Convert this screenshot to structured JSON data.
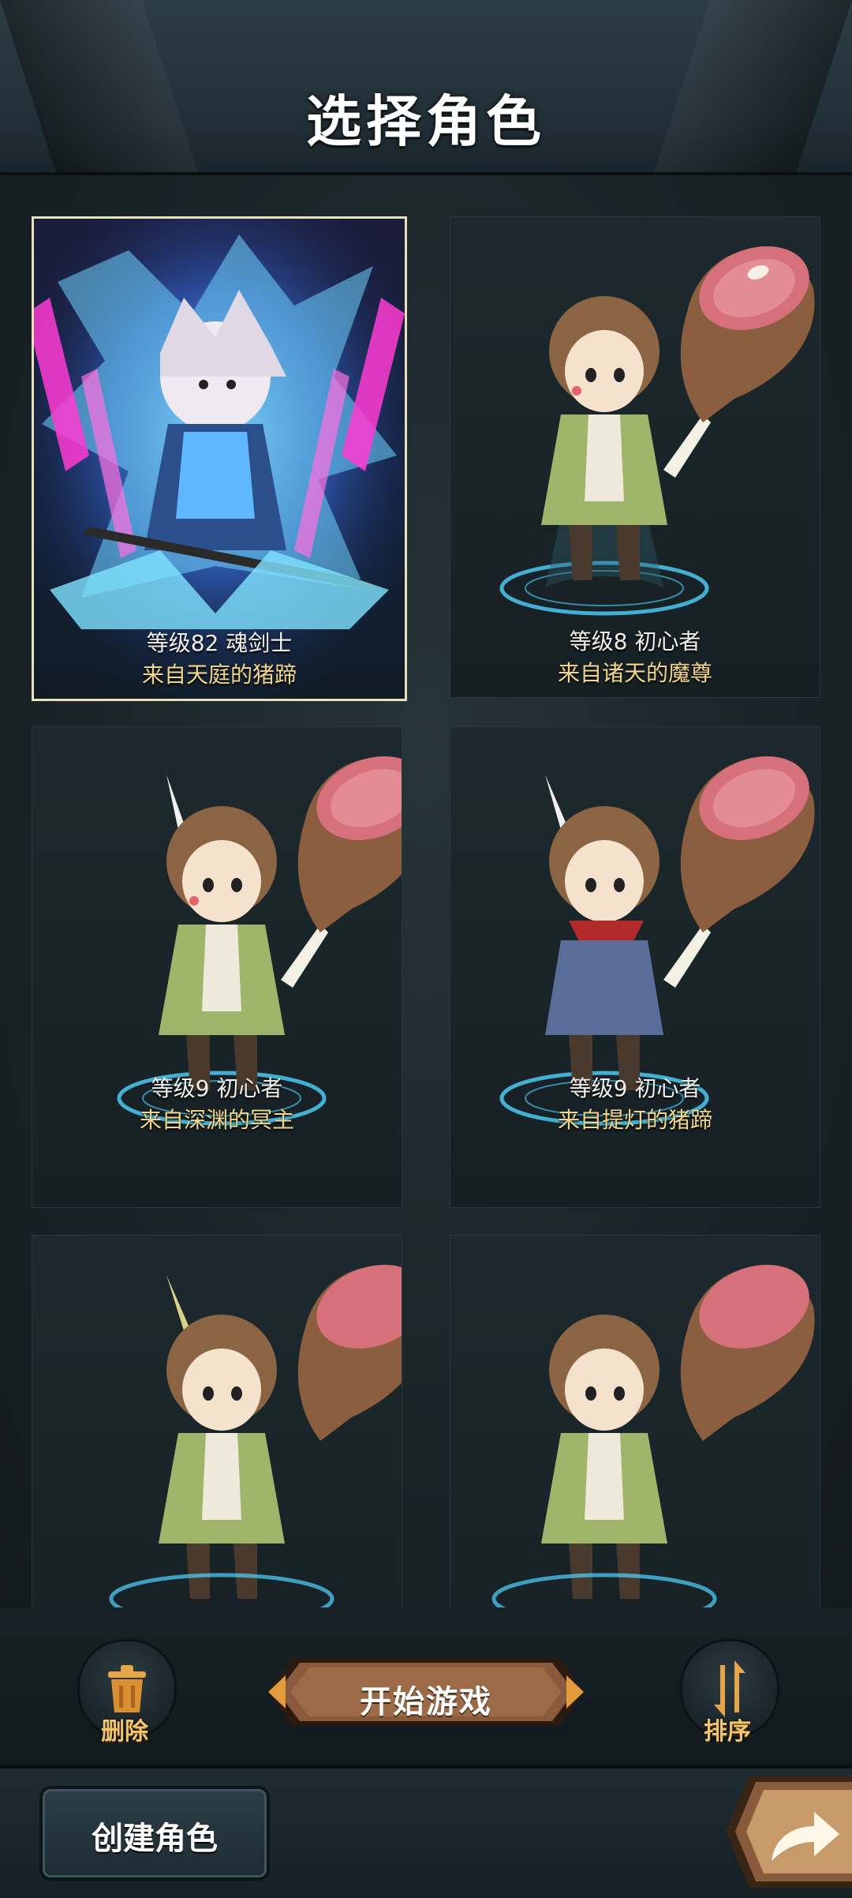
{
  "header": {
    "title": "选择角色"
  },
  "characters": [
    {
      "level": "等级82  魂剑士",
      "name": "来自天庭的猪蹄",
      "selected": true
    },
    {
      "level": "等级8  初心者",
      "name": "来自诸天的魔尊",
      "selected": false
    },
    {
      "level": "等级9  初心者",
      "name": "来自深渊的冥主",
      "selected": false
    },
    {
      "level": "等级9  初心者",
      "name": "来自提灯的猪蹄",
      "selected": false
    },
    {
      "level": "",
      "name": "",
      "selected": false
    },
    {
      "level": "",
      "name": "",
      "selected": false
    }
  ],
  "actions": {
    "delete_label": "删除",
    "start_label": "开始游戏",
    "sort_label": "排序",
    "create_label": "创建角色"
  },
  "icons": {
    "delete": "trash-can-icon",
    "sort": "sort-arrows-icon",
    "share": "share-arrow-icon"
  },
  "colors": {
    "accent_gold": "#f0d58a",
    "selected_border": "#e9e1b9",
    "button_bronze": "#8a5a3c"
  }
}
